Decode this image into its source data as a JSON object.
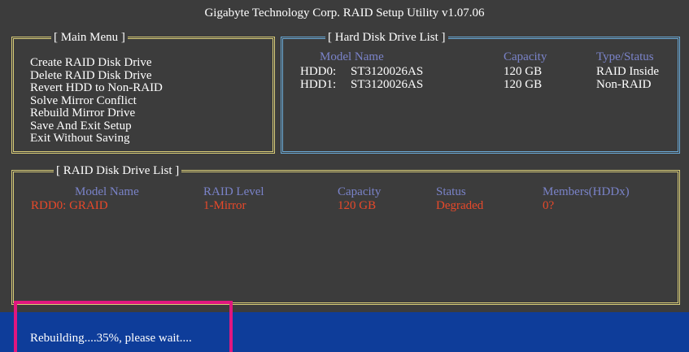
{
  "title": "Gigabyte Technology Corp.  RAID Setup Utility  v1.07.06",
  "main_menu": {
    "heading": "[ Main Menu ]",
    "items": [
      "Create RAID Disk Drive",
      "Delete RAID Disk Drive",
      "Revert HDD to Non-RAID",
      "Solve Mirror Conflict",
      "Rebuild Mirror Drive",
      "Save And Exit Setup",
      "Exit Without Saving"
    ]
  },
  "hdd_list": {
    "heading": "[ Hard Disk Drive List ]",
    "columns": [
      "Model Name",
      "Capacity",
      "Type/Status"
    ],
    "rows": [
      {
        "id": "HDD0:",
        "model": "ST3120026AS",
        "capacity": "120 GB",
        "status": "RAID Inside"
      },
      {
        "id": "HDD1:",
        "model": "ST3120026AS",
        "capacity": "120 GB",
        "status": "Non-RAID"
      }
    ]
  },
  "raid_list": {
    "heading": "[ RAID Disk Drive List ]",
    "columns": [
      "Model Name",
      "RAID Level",
      "Capacity",
      "Status",
      "Members(HDDx)"
    ],
    "rows": [
      {
        "model": "RDD0: GRAID",
        "level": "1-Mirror",
        "capacity": "120 GB",
        "status": "Degraded",
        "members": "0?"
      }
    ]
  },
  "status_bar": {
    "message": "Rebuilding....35%, please wait....",
    "progress_percent": 35
  },
  "colors": {
    "background": "#3c3c3c",
    "box_yellow": "#d8cc78",
    "box_blue": "#6aa9d6",
    "header_text": "#7a83c9",
    "raid_row_text": "#e8492a",
    "status_bar": "#0e3d9a",
    "highlight": "#e0177f"
  }
}
